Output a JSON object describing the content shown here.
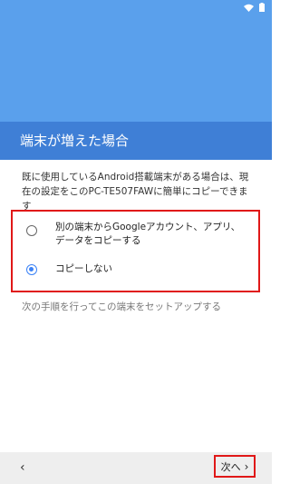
{
  "header": {
    "title": "端末が増えた場合"
  },
  "description": "既に使用しているAndroid搭載端末がある場合は、現在の設定をこのPC-TE507FAWに簡単にコピーできます",
  "options": [
    {
      "label": "別の端末からGoogleアカウント、アプリ、データをコピーする",
      "selected": false
    },
    {
      "label": "コピーしない",
      "selected": true
    }
  ],
  "setup_text": "次の手順を行ってこの端末をセットアップする",
  "nav": {
    "back_icon": "‹",
    "next_label": "次へ",
    "next_icon": "›"
  },
  "colors": {
    "accent": "#3b82f6",
    "highlight": "#e01818",
    "header": "#3f7fd6",
    "top": "#5aa0ec"
  }
}
